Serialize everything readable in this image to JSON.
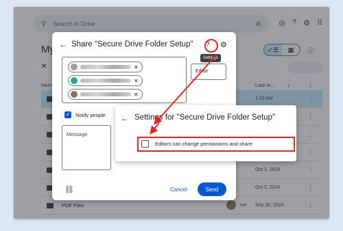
{
  "drive": {
    "search_placeholder": "Search in Drive",
    "page_title": "My",
    "columns": {
      "name": "Name",
      "last_modified": "Last m...",
      "sort": "↓",
      "more": "⋮"
    },
    "rows": [
      {
        "name": "",
        "owner": "",
        "date": "1:29 AM"
      },
      {
        "name": "",
        "owner": "",
        "date": ""
      },
      {
        "name": "",
        "owner": "",
        "date": ""
      },
      {
        "name": "",
        "owner": "",
        "date": ""
      },
      {
        "name": "",
        "owner": "",
        "date": "Oct 2, 2024"
      },
      {
        "name": "",
        "owner": "",
        "date": "Oct 2, 2024"
      },
      {
        "name": "PDF Files",
        "owner": "me",
        "date": "Sep 30, 2024"
      }
    ]
  },
  "share_dialog": {
    "title": "Share \"Secure Drive Folder Setup\"",
    "tooltip": "Settings",
    "role": "Editor",
    "notify_label": "Notify people",
    "message_placeholder": "Message",
    "cancel_label": "Cancel",
    "send_label": "Send"
  },
  "settings_dialog": {
    "title": "Settings for \"Secure Drive Folder Setup\"",
    "option_label": "Editors can change permissions and share"
  },
  "colors": {
    "accent": "#0b57d0",
    "highlight": "#e32422",
    "selected_row": "#c2e7ff"
  }
}
